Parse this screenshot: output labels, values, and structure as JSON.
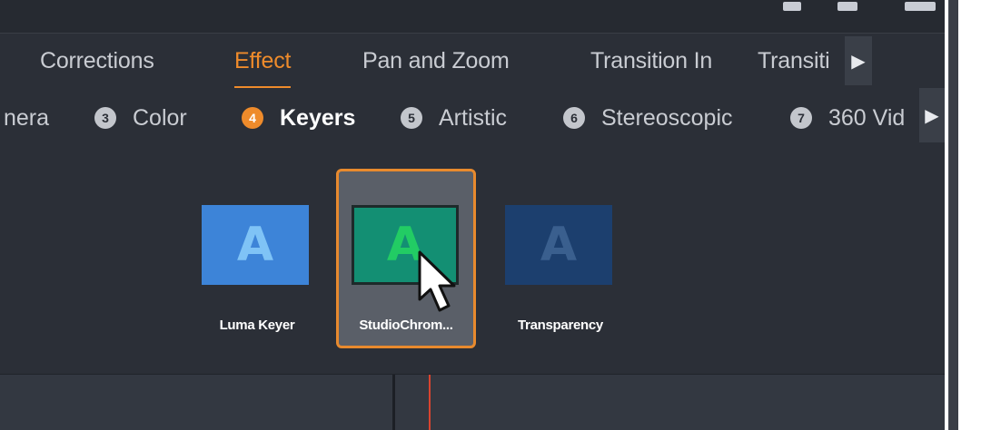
{
  "main_tabs": [
    {
      "label": "Corrections",
      "active": false
    },
    {
      "label": "Effect",
      "active": true
    },
    {
      "label": "Pan and Zoom",
      "active": false
    },
    {
      "label": "Transition In",
      "active": false
    },
    {
      "label": "Transiti",
      "active": false
    }
  ],
  "categories": [
    {
      "number": "",
      "label": "nera",
      "active": false
    },
    {
      "number": "3",
      "label": "Color",
      "active": false
    },
    {
      "number": "4",
      "label": "Keyers",
      "active": true
    },
    {
      "number": "5",
      "label": "Artistic",
      "active": false
    },
    {
      "number": "6",
      "label": "Stereoscopic",
      "active": false
    },
    {
      "number": "7",
      "label": "360 Vid",
      "active": false
    }
  ],
  "effects": [
    {
      "label": "Luma Keyer",
      "glyph": "A",
      "thumb_bg": "#3d84d8",
      "glyph_color": "#7fc3f6",
      "selected": false
    },
    {
      "label": "StudioChrom...",
      "glyph": "A",
      "thumb_bg": "#138f73",
      "glyph_color": "#22cc64",
      "selected": true
    },
    {
      "label": "Transparency",
      "glyph": "A",
      "thumb_bg": "#1c3f6e",
      "glyph_color": "#3a5f8e",
      "selected": false
    }
  ],
  "icons": {
    "scroll_right": "▶"
  },
  "colors": {
    "accent": "#ee8b2b",
    "background": "#2b2f37",
    "playhead": "#d9442f"
  }
}
